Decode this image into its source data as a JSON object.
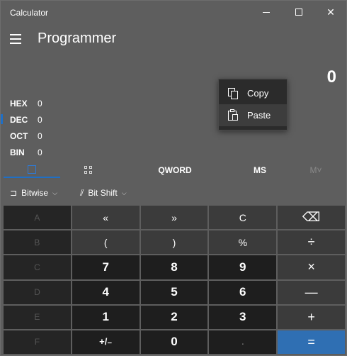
{
  "window": {
    "title": "Calculator",
    "minimize_glyph": "",
    "close_glyph": "✕"
  },
  "header": {
    "mode_title": "Programmer",
    "menu_icon": "hamburger-icon"
  },
  "display": {
    "value": "0"
  },
  "radix": [
    {
      "label": "HEX",
      "value": "0"
    },
    {
      "label": "DEC",
      "value": "0"
    },
    {
      "label": "OCT",
      "value": "0"
    },
    {
      "label": "BIN",
      "value": "0"
    }
  ],
  "tabs": {
    "keypad_icon": "keypad-icon",
    "bitpad_icon": "bit-toggle-icon",
    "word_size": "QWORD",
    "memory_store": "MS",
    "memory_list": "M˅"
  },
  "ops": {
    "bitwise_label": "Bitwise",
    "bitshift_label": "Bit Shift"
  },
  "keys": [
    [
      "A",
      "«",
      "»",
      "C",
      "⌫"
    ],
    [
      "B",
      "(",
      ")",
      "%",
      "÷"
    ],
    [
      "C",
      "7",
      "8",
      "9",
      "×"
    ],
    [
      "D",
      "4",
      "5",
      "6",
      "—"
    ],
    [
      "E",
      "1",
      "2",
      "3",
      "+"
    ],
    [
      "F",
      "+/₋",
      "0",
      ".",
      "="
    ]
  ],
  "context_menu": {
    "copy_label": "Copy",
    "paste_label": "Paste"
  },
  "colors": {
    "accent": "#2f6fb3",
    "active_indicator": "#1f6fc5"
  }
}
